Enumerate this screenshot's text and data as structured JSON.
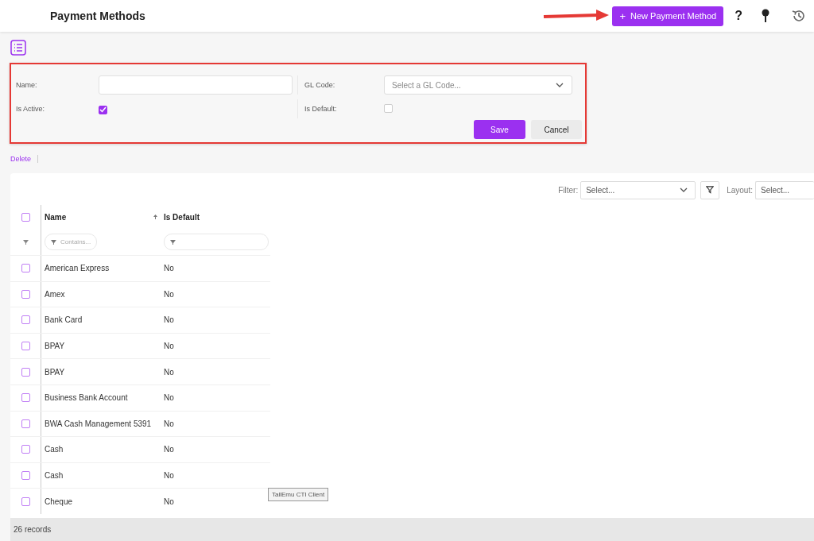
{
  "header": {
    "title": "Payment Methods",
    "new_button": "New Payment Method",
    "new_icon": "+",
    "help": "?"
  },
  "form": {
    "name_label": "Name:",
    "gl_label": "GL Code:",
    "gl_placeholder": "Select a GL Code...",
    "active_label": "Is Active:",
    "active_checked": true,
    "default_label": "Is Default:",
    "default_checked": false,
    "save": "Save",
    "cancel": "Cancel"
  },
  "actions": {
    "delete": "Delete"
  },
  "toolbar": {
    "filter_label": "Filter:",
    "filter_placeholder": "Select...",
    "layout_label": "Layout:",
    "layout_placeholder": "Select..."
  },
  "table": {
    "all_selected": false,
    "columns": [
      "Name",
      "Is Default"
    ],
    "name_filter_placeholder": "Contains...",
    "rows": [
      {
        "name": "American Express",
        "is_default": "No",
        "selected": false
      },
      {
        "name": "Amex",
        "is_default": "No",
        "selected": false
      },
      {
        "name": "Bank Card",
        "is_default": "No",
        "selected": false
      },
      {
        "name": "BPAY",
        "is_default": "No",
        "selected": false
      },
      {
        "name": "BPAY",
        "is_default": "No",
        "selected": false
      },
      {
        "name": "Business Bank Account",
        "is_default": "No",
        "selected": false
      },
      {
        "name": "BWA Cash Management 5391",
        "is_default": "No",
        "selected": false
      },
      {
        "name": "Cash",
        "is_default": "No",
        "selected": false
      },
      {
        "name": "Cash",
        "is_default": "No",
        "selected": false
      },
      {
        "name": "Cheque",
        "is_default": "No",
        "selected": false
      }
    ]
  },
  "tooltip": "TallEmu CTI Client",
  "status_bar": "26 records"
}
